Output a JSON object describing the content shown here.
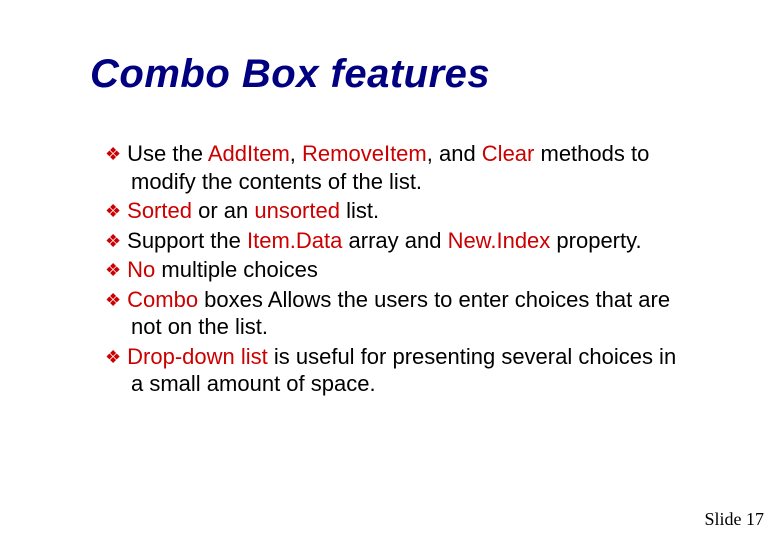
{
  "title": "Combo Box features",
  "bullets": [
    {
      "pre": "Use the ",
      "hl1": "AddItem",
      "mid1": ", ",
      "hl2": "RemoveItem",
      "mid2": ", and ",
      "hl3": "Clear",
      "post": " methods to modify the contents of the list."
    },
    {
      "pre": "",
      "hl1": "Sorted",
      "mid1": " or an ",
      "hl2": "unsorted",
      "mid2": "",
      "hl3": "",
      "post": " list."
    },
    {
      "pre": "Support the ",
      "hl1": "Item.Data",
      "mid1": " array and ",
      "hl2": "New.Index",
      "mid2": "",
      "hl3": "",
      "post": " property."
    },
    {
      "pre": "",
      "hl1": "No",
      "mid1": "",
      "hl2": "",
      "mid2": "",
      "hl3": "",
      "post": " multiple choices"
    },
    {
      "pre": "",
      "hl1": "Combo",
      "mid1": "",
      "hl2": "",
      "mid2": "",
      "hl3": "",
      "post": " boxes Allows the users to enter choices that are not on the list."
    },
    {
      "pre": "",
      "hl1": "Drop-down list",
      "mid1": "",
      "hl2": "",
      "mid2": "",
      "hl3": "",
      "post": " is useful for presenting several choices in a small amount of space."
    }
  ],
  "bullet_glyph": "❖",
  "footer": {
    "label": "Slide",
    "number": "17"
  }
}
